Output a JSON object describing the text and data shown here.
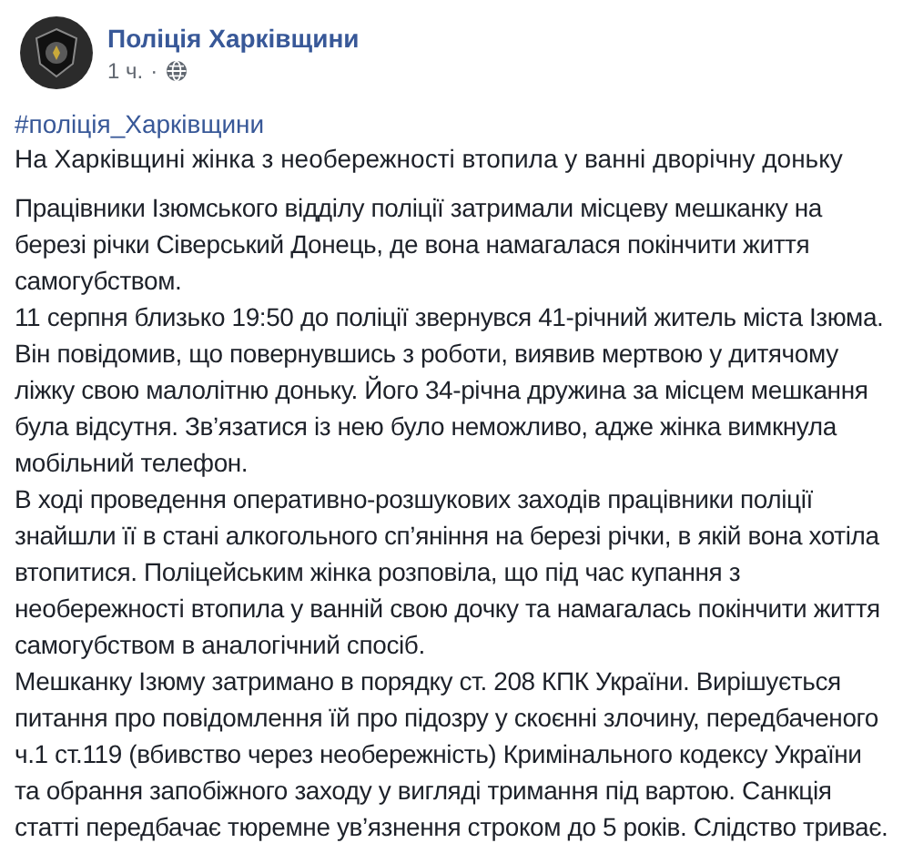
{
  "post": {
    "author": "Поліція Харківщини",
    "time": "1 ч.",
    "separator": "·",
    "hashtag": "#поліція_Харківщини",
    "headline": "На Харківщині жінка з необережності втопила у ванні дворічну доньку",
    "paragraphs": [
      "Працівники Ізюмського відділу поліції затримали місцеву мешканку на березі річки Сіверський Донець, де вона намагалася покінчити життя самогубством.",
      "11 серпня близько 19:50 до поліції звернувся 41-річний житель міста Ізюма. Він повідомив, що повернувшись з роботи, виявив мертвою у дитячому ліжку свою малолітню доньку. Його 34-річна дружина за місцем мешкання була відсутня. Зв’язатися із нею було неможливо, адже жінка вимкнула мобільний телефон.",
      "В ході проведення оперативно-розшукових заходів працівники поліції знайшли її в стані алкогольного сп’яніння на березі річки, в якій вона хотіла втопитися. Поліцейським жінка розповіла, що під час купання з необережності втопила у ванній свою дочку та намагалась покінчити життя самогубством в аналогічний спосіб.",
      "Мешканку Ізюму затримано в порядку ст. 208 КПК України. Вирішується питання про повідомлення їй про підозру у скоєнні злочину, передбаченого ч.1 ст.119 (вбивство через необережність) Кримінального кодексу України та обрання запобіжного заходу у вигляді тримання під вартою. Санкція статті передбачає тюремне ув’язнення строком до 5 років. Слідство триває."
    ]
  }
}
